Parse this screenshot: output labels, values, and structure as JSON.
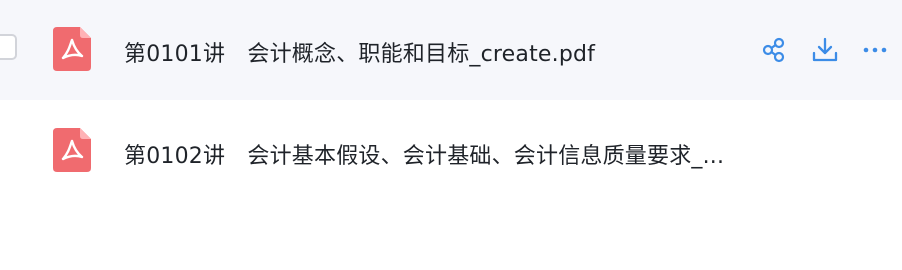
{
  "files": [
    {
      "name": "第0101讲　会计概念、职能和目标_create.pdf",
      "icon": "pdf-icon"
    },
    {
      "name": "第0102讲　会计基本假设、会计基础、会计信息质量要求_...",
      "icon": "pdf-icon"
    }
  ],
  "actions": {
    "share": "share-icon",
    "download": "download-icon",
    "more": "more-icon"
  },
  "colors": {
    "pdf_icon": "#f06b6f",
    "action_icon": "#3c8ce7",
    "hover_background": "#f6f7fb"
  }
}
